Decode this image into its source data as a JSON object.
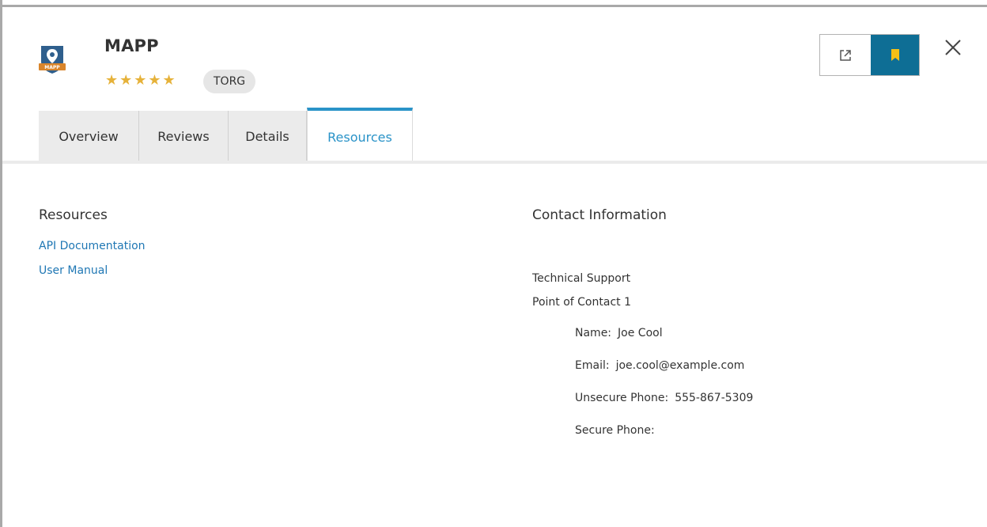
{
  "header": {
    "app_title": "MAPP",
    "logo_text": "MAPP",
    "rating_stars": "★★★★★",
    "rating_value": 5,
    "org_badge": "TORG",
    "bookmark_color": "#0e6e95",
    "star_color": "#e6b23a"
  },
  "tabs": [
    {
      "label": "Overview",
      "active": false
    },
    {
      "label": "Reviews",
      "active": false
    },
    {
      "label": "Details",
      "active": false
    },
    {
      "label": "Resources",
      "active": true
    }
  ],
  "resources": {
    "heading": "Resources",
    "links": [
      "API Documentation",
      "User Manual"
    ]
  },
  "contact": {
    "heading": "Contact Information",
    "type": "Technical Support",
    "poc_label": "Point of Contact 1",
    "fields": [
      {
        "label": "Name:",
        "value": "Joe Cool"
      },
      {
        "label": "Email:",
        "value": "joe.cool@example.com"
      },
      {
        "label": "Unsecure Phone:",
        "value": "555-867-5309"
      },
      {
        "label": "Secure Phone:",
        "value": ""
      }
    ]
  },
  "icons": {
    "open": "external-link-icon",
    "bookmark": "bookmark-icon",
    "close": "close-icon",
    "logo": "map-pin-shield-icon"
  }
}
